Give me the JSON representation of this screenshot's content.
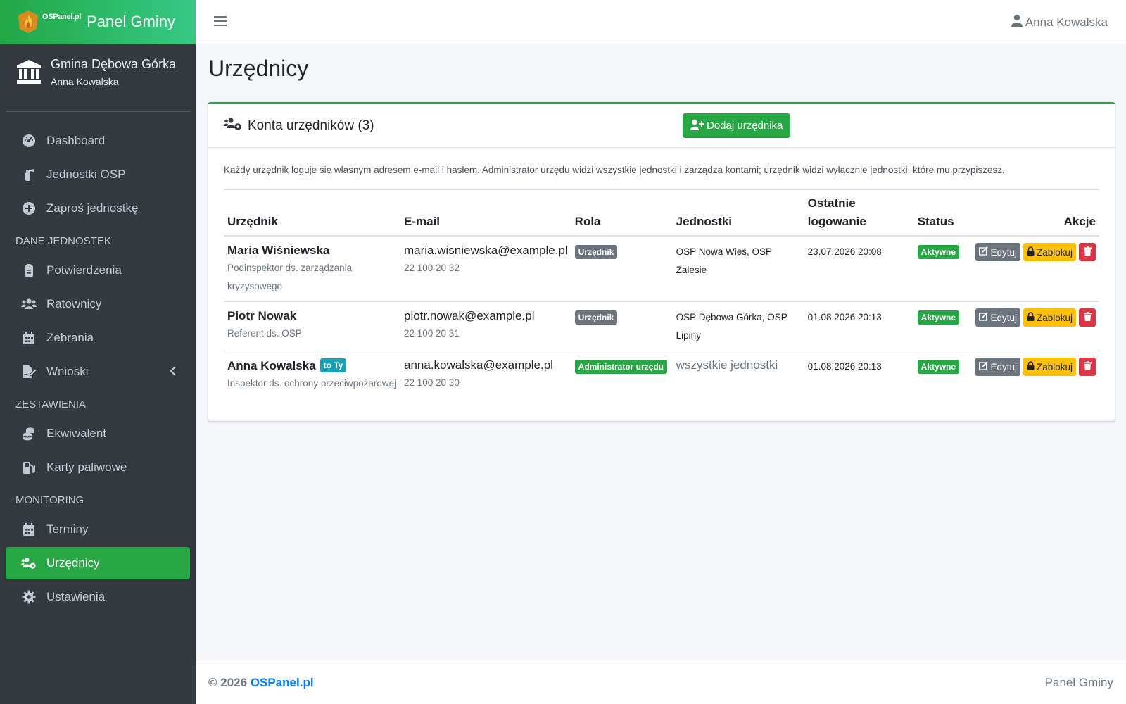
{
  "brand": {
    "logo_text": "OSPanel.pl",
    "title": "Panel Gminy"
  },
  "user_panel": {
    "gmina": "Gmina Dębowa Górka",
    "user": "Anna Kowalska"
  },
  "sidebar": {
    "items": [
      {
        "label": "Dashboard",
        "icon": "tachometer-icon"
      },
      {
        "label": "Jednostki OSP",
        "icon": "fire-extinguisher-icon"
      },
      {
        "label": "Zaproś jednostkę",
        "icon": "plus-circle-icon"
      }
    ],
    "sections": [
      {
        "header": "DANE JEDNOSTEK",
        "items": [
          {
            "label": "Potwierdzenia",
            "icon": "clipboard-icon"
          },
          {
            "label": "Ratownicy",
            "icon": "users-icon"
          },
          {
            "label": "Zebrania",
            "icon": "calendar-icon"
          },
          {
            "label": "Wnioski",
            "icon": "file-signature-icon"
          }
        ]
      },
      {
        "header": "ZESTAWIENIA",
        "items": [
          {
            "label": "Ekwiwalent",
            "icon": "coins-icon"
          },
          {
            "label": "Karty paliwowe",
            "icon": "gas-pump-icon"
          }
        ]
      },
      {
        "header": "MONITORING",
        "items": [
          {
            "label": "Terminy",
            "icon": "calendar-icon"
          },
          {
            "label": "Urzędnicy",
            "icon": "users-cog-icon"
          },
          {
            "label": "Ustawienia",
            "icon": "cog-icon"
          }
        ]
      }
    ]
  },
  "topbar": {
    "user": "Anna Kowalska"
  },
  "page": {
    "title": "Urzędnicy"
  },
  "card": {
    "title": "Konta urzędników (3)",
    "add_button": "Dodaj urzędnika",
    "info": "Każdy urzędnik loguje się własnym adresem e-mail i hasłem. Administrator urzędu widzi wszystkie jednostki i zarządza kontami; urzędnik widzi wyłącznie jednostki, które mu przypiszesz."
  },
  "table": {
    "headers": {
      "official": "Urzędnik",
      "email": "E-mail",
      "role": "Rola",
      "units": "Jednostki",
      "last_login_1": "Ostatnie",
      "last_login_2": "logowanie",
      "status": "Status",
      "actions": "Akcje"
    },
    "rows": [
      {
        "name": "Maria Wiśniewska",
        "position": "Podinspektor ds. zarządzania kryzysowego",
        "email": "maria.wisniewska@example.pl",
        "phone": "22 100 20 32",
        "role": "Urzędnik",
        "units": "OSP Nowa Wieś, OSP Zalesie",
        "last_login": "23.07.2026 20:08",
        "status": "Aktywne"
      },
      {
        "name": "Piotr Nowak",
        "position": "Referent ds. OSP",
        "email": "piotr.nowak@example.pl",
        "phone": "22 100 20 31",
        "role": "Urzędnik",
        "units": "OSP Dębowa Górka, OSP Lipiny",
        "last_login": "01.08.2026 20:13",
        "status": "Aktywne"
      },
      {
        "name": "Anna Kowalska",
        "you_badge": "to Ty",
        "position": "Inspektor ds. ochrony przeciwpożarowej",
        "email": "anna.kowalska@example.pl",
        "phone": "22 100 20 30",
        "role": "Administrator urzędu",
        "units": "wszystkie jednostki",
        "last_login": "01.08.2026 20:13",
        "status": "Aktywne"
      }
    ],
    "actions": {
      "edit": "Edytuj",
      "block": "Zablokuj"
    }
  },
  "footer": {
    "copyright": "© 2026",
    "link": "OSPanel.pl",
    "right": "Panel Gminy"
  },
  "colors": {
    "accent": "#28a745",
    "sidebar": "#343a40",
    "warning": "#ffc107",
    "danger": "#dc3545",
    "info": "#17a2b8"
  }
}
